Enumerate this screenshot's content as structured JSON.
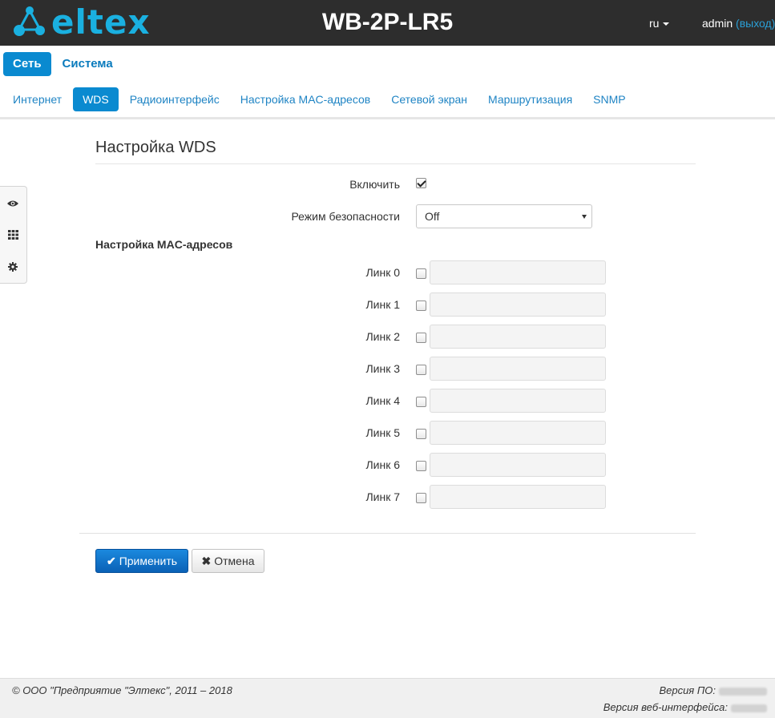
{
  "header": {
    "logo_text": "eltex",
    "device": "WB-2P-LR5",
    "lang": "ru",
    "user": "admin",
    "logout": "(выход)"
  },
  "topnav": [
    "Сеть",
    "Система"
  ],
  "subnav": [
    "Интернет",
    "WDS",
    "Радиоинтерфейс",
    "Настройка MAC-адресов",
    "Сетевой экран",
    "Маршрутизация",
    "SNMP"
  ],
  "form": {
    "title": "Настройка WDS",
    "enable_label": "Включить",
    "enable_checked": true,
    "security_label": "Режим безопасности",
    "security_value": "Off",
    "mac_section": "Настройка MAC-адресов",
    "links": [
      {
        "label": "Линк 0",
        "value": ""
      },
      {
        "label": "Линк 1",
        "value": ""
      },
      {
        "label": "Линк 2",
        "value": ""
      },
      {
        "label": "Линк 3",
        "value": ""
      },
      {
        "label": "Линк 4",
        "value": ""
      },
      {
        "label": "Линк 5",
        "value": ""
      },
      {
        "label": "Линк 6",
        "value": ""
      },
      {
        "label": "Линк 7",
        "value": ""
      }
    ],
    "apply": "Применить",
    "cancel": "Отмена"
  },
  "footer": {
    "copyright": "© ООО \"Предприятие \"Элтекс\", 2011 – 2018",
    "fw_label": "Версия ПО:",
    "web_label": "Версия веб-интерфейса:"
  },
  "colors": {
    "header_bg": "#2d2d2d",
    "brand": "#1ab0e0",
    "accent": "#0a8ad0",
    "link": "#1f84c4"
  }
}
